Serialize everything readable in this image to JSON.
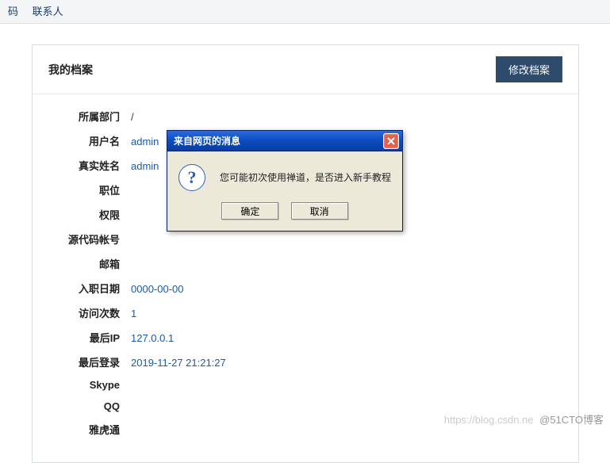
{
  "nav": {
    "item1": "码",
    "item2": "联系人"
  },
  "panel": {
    "title": "我的档案",
    "edit_label": "修改档案"
  },
  "profile": {
    "fields": [
      {
        "label": "所属部门",
        "value": "/",
        "plain": true
      },
      {
        "label": "用户名",
        "value": "admin"
      },
      {
        "label": "真实姓名",
        "value": "admin"
      },
      {
        "label": "职位",
        "value": ""
      },
      {
        "label": "权限",
        "value": ""
      },
      {
        "label": "源代码帐号",
        "value": ""
      },
      {
        "label": "邮箱",
        "value": ""
      },
      {
        "label": "入职日期",
        "value": "0000-00-00"
      },
      {
        "label": "访问次数",
        "value": "1"
      },
      {
        "label": "最后IP",
        "value": "127.0.0.1"
      },
      {
        "label": "最后登录",
        "value": "2019-11-27 21:21:27"
      },
      {
        "label": "Skype",
        "value": ""
      },
      {
        "label": "QQ",
        "value": ""
      },
      {
        "label": "雅虎通",
        "value": ""
      }
    ]
  },
  "dialog": {
    "title": "来自网页的消息",
    "icon_glyph": "?",
    "message": "您可能初次使用禅道，是否进入新手教程",
    "ok_label": "确定",
    "cancel_label": "取消"
  },
  "watermark": {
    "faint": "https://blog.csdn.ne",
    "text": "@51CTO博客"
  }
}
